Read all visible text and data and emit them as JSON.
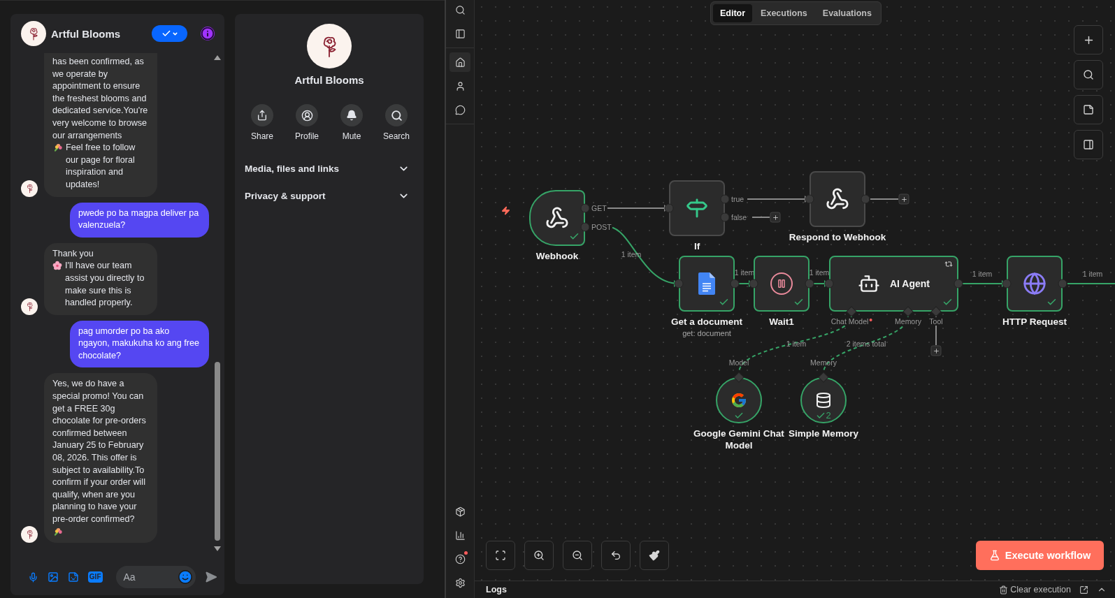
{
  "messenger": {
    "chat": {
      "title": "Artful Blooms",
      "messages": [
        {
          "kind": "incoming",
          "avatar": true,
          "cut_top": true,
          "parts": [
            {
              "kind": "text",
              "text": "has been confirmed, as we operate by appointment to ensure the freshest blooms and dedicated service.You're very welcome to browse our arrangements"
            },
            {
              "kind": "bouquet"
            },
            {
              "kind": "text",
              "text": "Feel free to follow our page for floral inspiration and updates!"
            }
          ]
        },
        {
          "kind": "outgoing",
          "avatar": false,
          "cut_top": false,
          "parts": [
            {
              "kind": "text",
              "text": "pwede po ba magpa deliver pa valenzuela?"
            }
          ]
        },
        {
          "kind": "incoming",
          "avatar": true,
          "cut_top": false,
          "parts": [
            {
              "kind": "text",
              "text": "Thank you"
            },
            {
              "kind": "blossom"
            },
            {
              "kind": "text",
              "text": "I'll have our team assist you directly to make sure this is handled properly."
            }
          ]
        },
        {
          "kind": "outgoing",
          "avatar": false,
          "cut_top": false,
          "parts": [
            {
              "kind": "text",
              "text": "pag umorder po ba ako ngayon, makukuha ko ang free chocolate?"
            }
          ]
        },
        {
          "kind": "incoming",
          "avatar": true,
          "cut_top": false,
          "parts": [
            {
              "kind": "text",
              "text": "Yes, we do have a special promo! You can get a FREE 30g chocolate for pre-orders confirmed between January 25 to February 08, 2026. This offer is subject to availability.To confirm if your order will qualify, when are you planning to have your pre-order confirmed?"
            },
            {
              "kind": "bouquet"
            }
          ]
        }
      ],
      "composer": {
        "gif": "GIF",
        "placeholder": "Aa"
      }
    },
    "profile": {
      "name": "Artful Blooms",
      "actions": [
        {
          "kind": "share",
          "label": "Share"
        },
        {
          "kind": "profile",
          "label": "Profile"
        },
        {
          "kind": "mute",
          "label": "Mute"
        },
        {
          "kind": "search",
          "label": "Search"
        }
      ],
      "sections": [
        {
          "label": "Media, files and links",
          "expanded": false
        },
        {
          "label": "Privacy & support",
          "expanded": false
        }
      ]
    }
  },
  "n8n": {
    "sidebar": [
      {
        "kind": "search",
        "selected": false,
        "badge": false
      },
      {
        "kind": "panel",
        "selected": false,
        "badge": false
      },
      {
        "kind": "home",
        "selected": true,
        "badge": false
      },
      {
        "kind": "user",
        "selected": false,
        "badge": false
      },
      {
        "kind": "chat",
        "selected": false,
        "badge": false
      },
      {
        "kind": "templates",
        "selected": false,
        "badge": false
      },
      {
        "kind": "insights",
        "selected": false,
        "badge": false
      },
      {
        "kind": "help",
        "selected": false,
        "badge": true
      },
      {
        "kind": "settings",
        "selected": false,
        "badge": false
      }
    ],
    "tabs": [
      {
        "label": "Editor",
        "selected": true
      },
      {
        "label": "Executions",
        "selected": false
      },
      {
        "label": "Evaluations",
        "selected": false
      }
    ],
    "nodes": [
      {
        "kind": "webhook",
        "name": "Webhook",
        "success": true,
        "trigger": true,
        "outputs": [
          "GET",
          "POST"
        ]
      },
      {
        "kind": "if",
        "name": "If",
        "success": false,
        "trigger": false,
        "outputs": [
          "true",
          "false"
        ]
      },
      {
        "kind": "respond",
        "name": "Respond to Webhook",
        "success": false,
        "trigger": false
      },
      {
        "kind": "document",
        "name": "Get a document",
        "subtitle": "get: document",
        "success": true,
        "trigger": false
      },
      {
        "kind": "wait",
        "name": "Wait1",
        "success": true,
        "trigger": false
      },
      {
        "kind": "agent",
        "name": "AI Agent",
        "success": true,
        "trigger": false,
        "ports": [
          {
            "label": "Chat Model",
            "required": true
          },
          {
            "label": "Memory",
            "required": false
          },
          {
            "label": "Tool",
            "required": false
          }
        ]
      },
      {
        "kind": "http",
        "name": "HTTP Request",
        "success": true,
        "trigger": false
      },
      {
        "kind": "model",
        "name": "Google Gemini Chat Model",
        "input": "Model",
        "success": true,
        "trigger": false
      },
      {
        "kind": "memory",
        "name": "Simple Memory",
        "input": "Memory",
        "success": true,
        "trigger": false,
        "runs": "2"
      }
    ],
    "connections": [
      {
        "kind": "solid",
        "active": false
      },
      {
        "kind": "solid",
        "active": true,
        "label": "1 item"
      },
      {
        "kind": "solid",
        "active": false
      },
      {
        "kind": "solid",
        "active": false
      },
      {
        "kind": "solid",
        "active": false
      },
      {
        "kind": "solid",
        "active": true,
        "label": "1 item"
      },
      {
        "kind": "solid",
        "active": true,
        "label": "1 item"
      },
      {
        "kind": "solid",
        "active": true,
        "label": "1 item"
      },
      {
        "kind": "solid",
        "active": true,
        "label": "1 item"
      },
      {
        "kind": "dashed",
        "active": true,
        "label": "1 item"
      },
      {
        "kind": "dashed",
        "active": true,
        "label": "2 items total"
      },
      {
        "kind": "solid",
        "active": false
      }
    ],
    "execute": "Execute workflow",
    "logs": {
      "title": "Logs",
      "clear": "Clear execution"
    }
  }
}
